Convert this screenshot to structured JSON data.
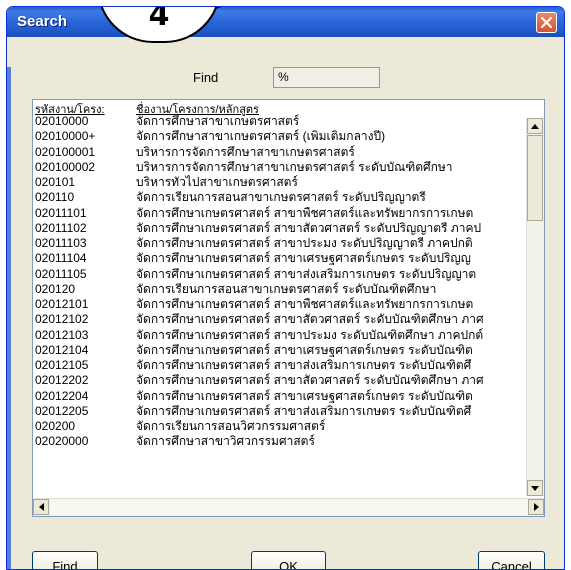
{
  "window": {
    "title": "Search",
    "callout_number": "4"
  },
  "search": {
    "label": "Find",
    "value": "%"
  },
  "list": {
    "columns": [
      "รหัสงาน/โครง:",
      "ชื่องาน/โครงการ/หลักสูตร"
    ],
    "rows": [
      {
        "code": "02010000",
        "name": "จัดการศึกษาสาขาเกษตรศาสตร์"
      },
      {
        "code": "02010000+",
        "name": "จัดการศึกษาสาขาเกษตรศาสตร์ (เพิ่มเติมกลางปี)"
      },
      {
        "code": "020100001",
        "name": "บริหารการจัดการศึกษาสาขาเกษตรศาสตร์"
      },
      {
        "code": "020100002",
        "name": "บริหารการจัดการศึกษาสาขาเกษตรศาสตร์ ระดับบัณฑิตศึกษา"
      },
      {
        "code": "020101",
        "name": "บริหารทั่วไปสาขาเกษตรศาสตร์"
      },
      {
        "code": "020110",
        "name": "จัดการเรียนการสอนสาขาเกษตรศาสตร์ ระดับปริญญาตรี"
      },
      {
        "code": "02011101",
        "name": "จัดการศึกษาเกษตรศาสตร์ สาขาพืชศาสตร์และทรัพยากรการเกษต"
      },
      {
        "code": "02011102",
        "name": "จัดการศึกษาเกษตรศาสตร์ สาขาสัตวศาสตร์ ระดับปริญญาตรี ภาคป"
      },
      {
        "code": "02011103",
        "name": "จัดการศึกษาเกษตรศาสตร์ สาขาประมง ระดับปริญญาตรี ภาคปกติ"
      },
      {
        "code": "02011104",
        "name": "จัดการศึกษาเกษตรศาสตร์ สาขาเศรษฐศาสตร์เกษตร ระดับปริญญ"
      },
      {
        "code": "02011105",
        "name": "จัดการศึกษาเกษตรศาสตร์ สาขาส่งเสริมการเกษตร ระดับปริญญาต"
      },
      {
        "code": "020120",
        "name": "จัดการเรียนการสอนสาขาเกษตรศาสตร์ ระดับบัณฑิตศึกษา"
      },
      {
        "code": "02012101",
        "name": "จัดการศึกษาเกษตรศาสตร์ สาขาพืชศาสตร์และทรัพยากรการเกษต"
      },
      {
        "code": "02012102",
        "name": "จัดการศึกษาเกษตรศาสตร์ สาขาสัตวศาสตร์ ระดับบัณฑิตศึกษา ภาศ"
      },
      {
        "code": "02012103",
        "name": "จัดการศึกษาเกษตรศาสตร์ สาขาประมง ระดับบัณฑิตศึกษา ภาคปกต์"
      },
      {
        "code": "02012104",
        "name": "จัดการศึกษาเกษตรศาสตร์ สาขาเศรษฐศาสตร์เกษตร ระดับบัณฑิต"
      },
      {
        "code": "02012105",
        "name": "จัดการศึกษาเกษตรศาสตร์ สาขาส่งเสริมการเกษตร ระดับบัณฑิตศึ"
      },
      {
        "code": "02012202",
        "name": "จัดการศึกษาเกษตรศาสตร์ สาขาสัตวศาสตร์ ระดับบัณฑิตศึกษา ภาศ"
      },
      {
        "code": "02012204",
        "name": "จัดการศึกษาเกษตรศาสตร์ สาขาเศรษฐศาสตร์เกษตร ระดับบัณฑิต"
      },
      {
        "code": "02012205",
        "name": "จัดการศึกษาเกษตรศาสตร์ สาขาส่งเสริมการเกษตร ระดับบัณฑิตศึ"
      },
      {
        "code": "020200",
        "name": "จัดการเรียนการสอนวิศวกรรมศาสตร์"
      },
      {
        "code": "02020000",
        "name": "จัดการศึกษาสาขาวิศวกรรมศาสตร์"
      }
    ]
  },
  "buttons": {
    "find": "Find",
    "ok": "OK",
    "cancel": "Cancel"
  },
  "icons": {
    "close": "close-icon",
    "scroll_up": "arrow-up-icon",
    "scroll_down": "arrow-down-icon",
    "scroll_left": "arrow-left-icon",
    "scroll_right": "arrow-right-icon"
  },
  "colors": {
    "titlebar": "#2b66d9",
    "close_button": "#d4552f",
    "dialog_background": "#ece9d8"
  }
}
